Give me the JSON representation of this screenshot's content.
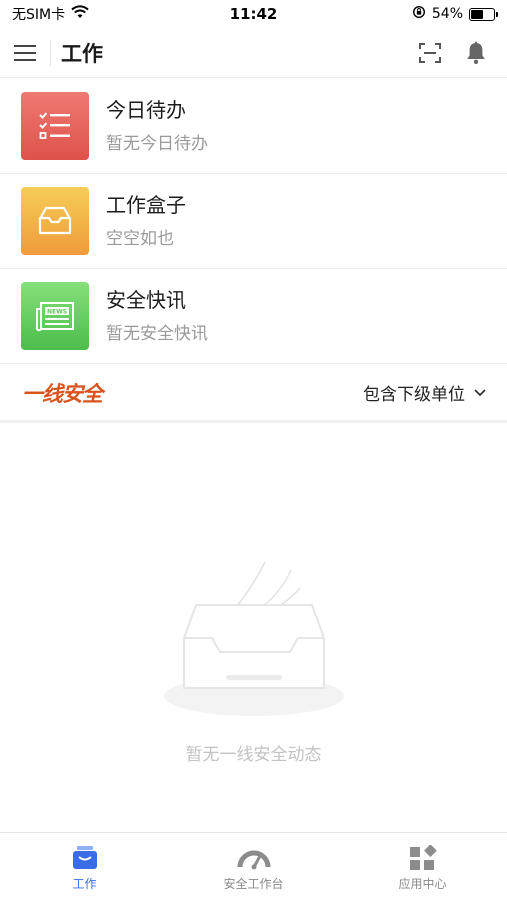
{
  "status_bar": {
    "carrier": "无SIM卡",
    "time": "11:42",
    "battery_percent": "54%",
    "battery_level": 0.54
  },
  "navbar": {
    "title": "工作"
  },
  "entries": [
    {
      "title": "今日待办",
      "subtitle": "暂无今日待办",
      "icon": "checklist-icon"
    },
    {
      "title": "工作盒子",
      "subtitle": "空空如也",
      "icon": "inbox-icon"
    },
    {
      "title": "安全快讯",
      "subtitle": "暂无安全快讯",
      "icon": "news-icon"
    }
  ],
  "section": {
    "brand": "一线安全",
    "filter_label": "包含下级单位"
  },
  "empty_state": {
    "text": "暂无一线安全动态"
  },
  "tabbar": {
    "tabs": [
      {
        "label": "工作",
        "icon": "work-tab-icon",
        "active": true
      },
      {
        "label": "安全工作台",
        "icon": "gauge-icon",
        "active": false
      },
      {
        "label": "应用中心",
        "icon": "app-grid-icon",
        "active": false
      }
    ]
  },
  "colors": {
    "accent": "#3a6ce6",
    "brand": "#d9541c",
    "todo_icon_bg": "#e4605a",
    "box_icon_bg": "#f2b548",
    "news_icon_bg": "#68cf62"
  }
}
